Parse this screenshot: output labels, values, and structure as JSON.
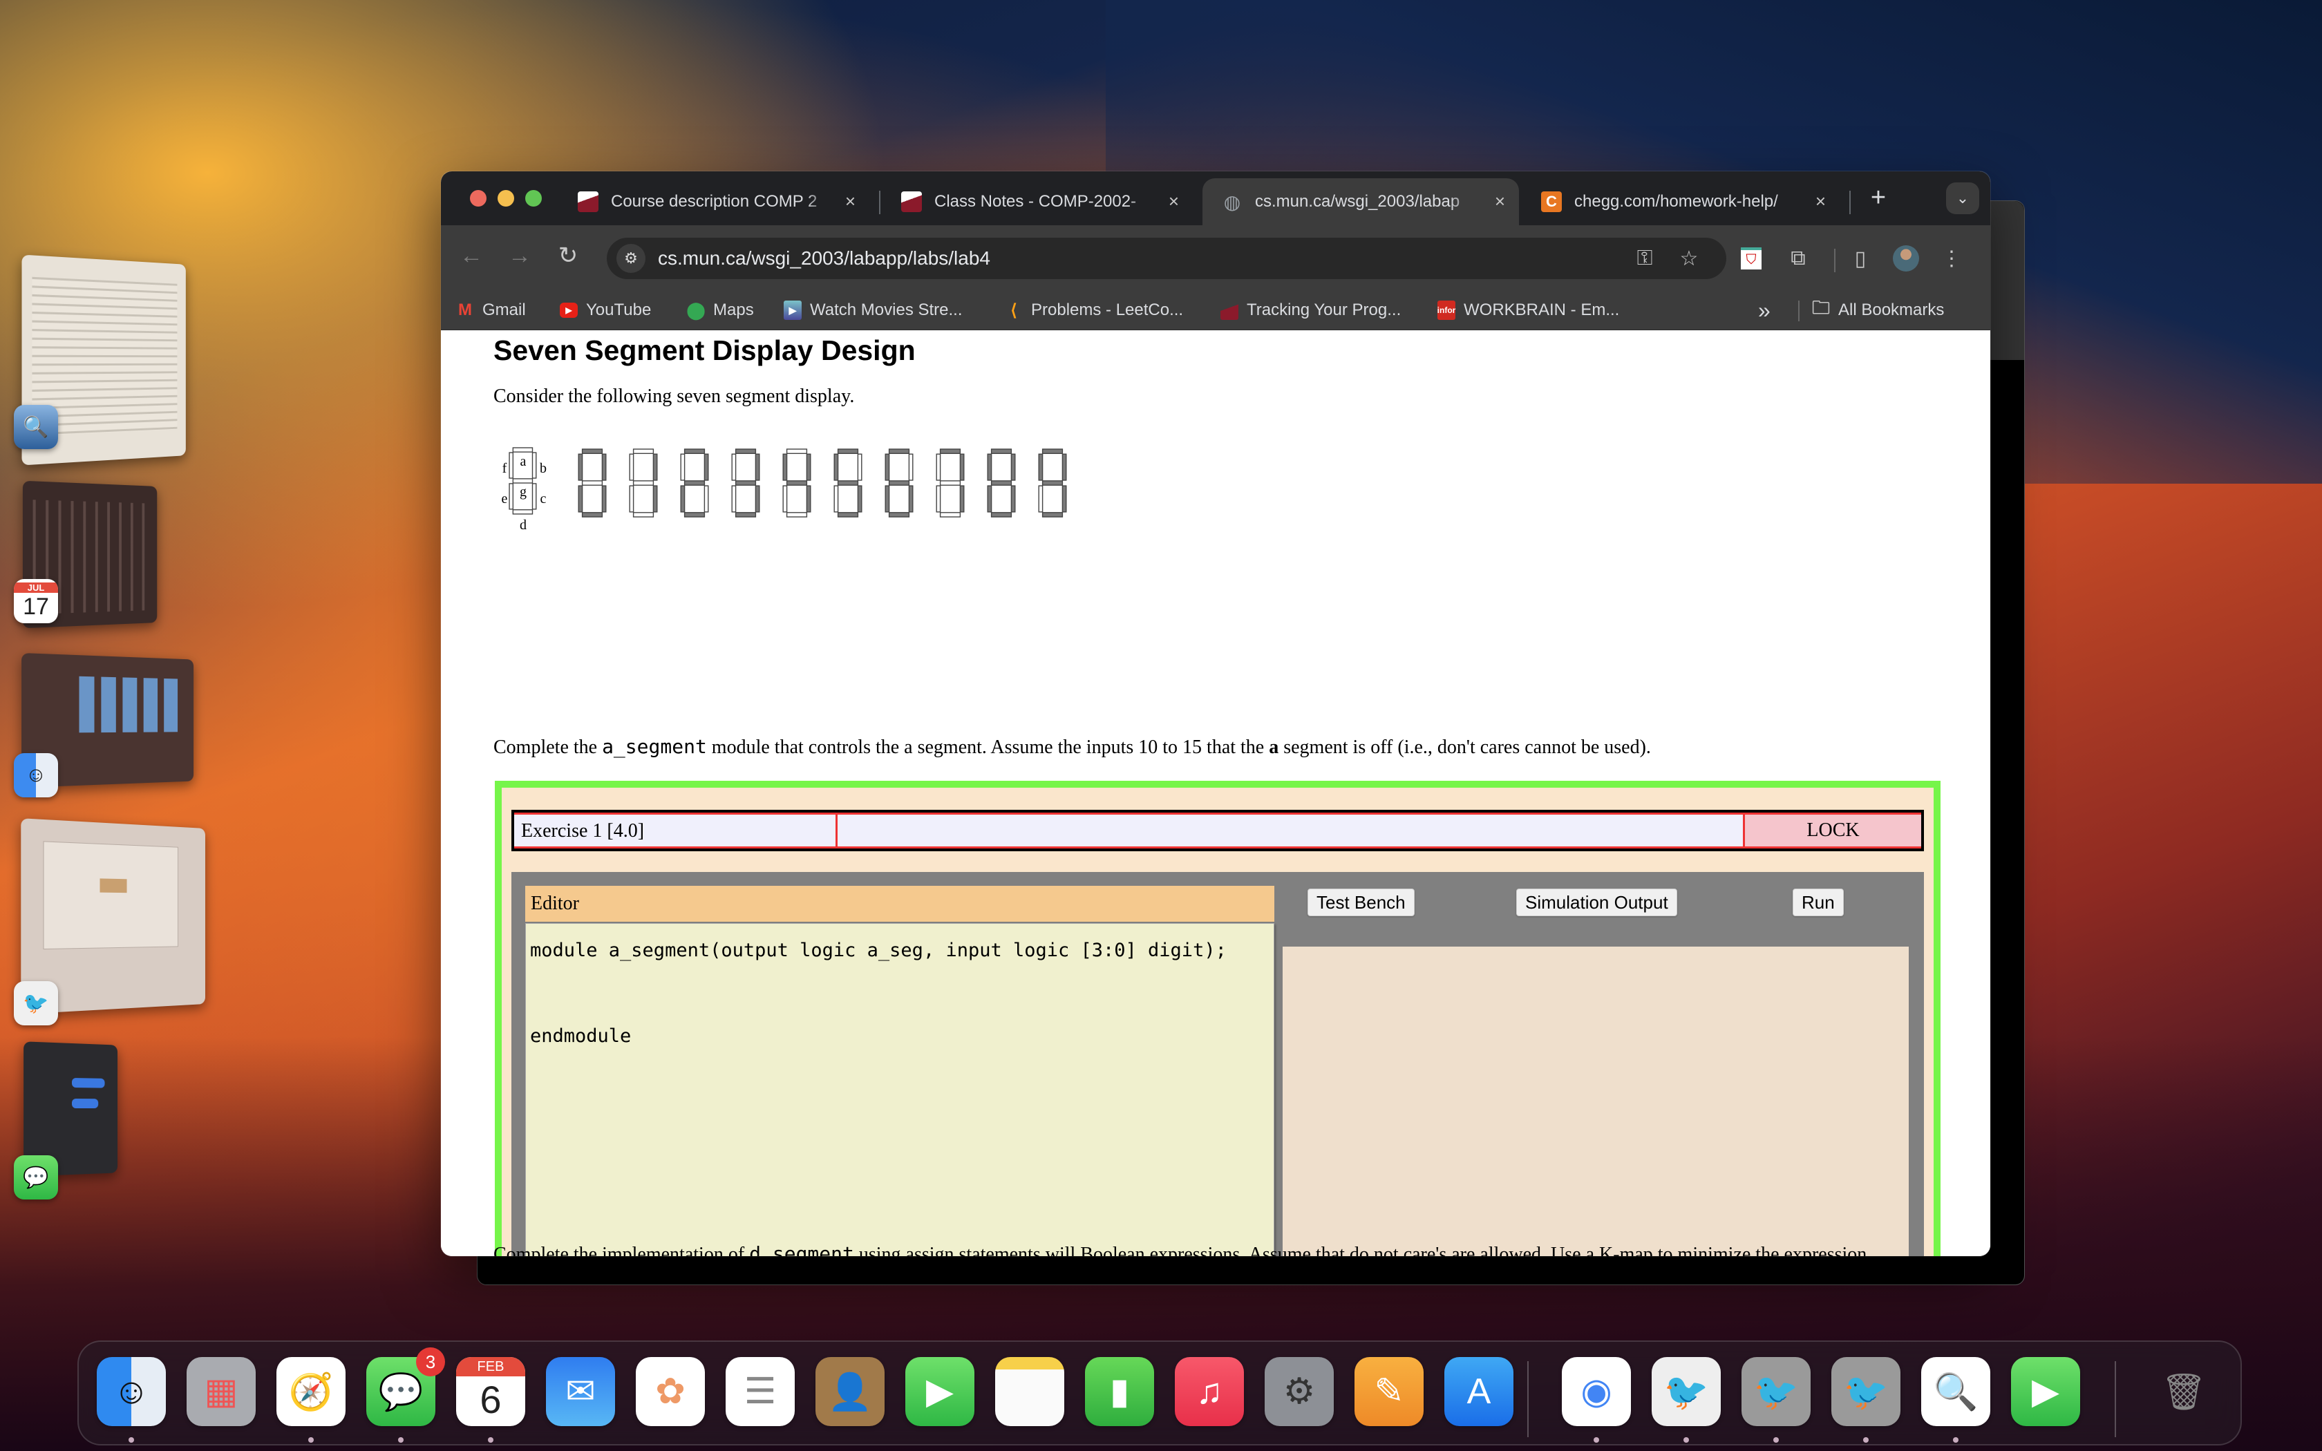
{
  "desktop": {
    "stage_manager": [
      {
        "name": "preview-window",
        "app": "Preview"
      },
      {
        "name": "calendar-window",
        "app": "Calendar",
        "app_badge_month": "JUL",
        "app_badge_day": "17"
      },
      {
        "name": "finder-window",
        "app": "Finder"
      },
      {
        "name": "bluej-window",
        "app": "BlueJ"
      },
      {
        "name": "messages-window",
        "app": "Messages"
      }
    ]
  },
  "browser": {
    "tabs": [
      {
        "title": "Course description COMP 2",
        "favicon": "memorial-university-icon",
        "active": false
      },
      {
        "title": "Class Notes - COMP-2002-",
        "favicon": "memorial-university-icon",
        "active": false
      },
      {
        "title": "cs.mun.ca/wsgi_2003/labap",
        "favicon": "globe-icon",
        "active": true
      },
      {
        "title": "chegg.com/homework-help/",
        "favicon": "chegg-icon",
        "active": false
      }
    ],
    "new_tab_label": "+",
    "url": "cs.mun.ca/wsgi_2003/labapp/labs/lab4",
    "bookmarks": [
      {
        "label": "Gmail",
        "icon": "gmail-icon"
      },
      {
        "label": "YouTube",
        "icon": "youtube-icon"
      },
      {
        "label": "Maps",
        "icon": "maps-icon"
      },
      {
        "label": "Watch Movies Stre...",
        "icon": "play-icon"
      },
      {
        "label": "Problems - LeetCo...",
        "icon": "leetcode-icon"
      },
      {
        "label": "Tracking Your Prog...",
        "icon": "memorial-university-icon"
      },
      {
        "label": "WORKBRAIN - Em...",
        "icon": "infor-icon",
        "icon_text": "infor"
      }
    ],
    "overflow_label": "»",
    "all_bookmarks_label": "All Bookmarks"
  },
  "page": {
    "title": "Seven Segment Display Design",
    "intro": "Consider the following seven segment display.",
    "segment_legend": {
      "a": "a",
      "b": "b",
      "c": "c",
      "d": "d",
      "e": "e",
      "f": "f",
      "g": "g"
    },
    "digits": [
      {
        "digit": 0,
        "on": [
          "a",
          "b",
          "c",
          "d",
          "e",
          "f"
        ]
      },
      {
        "digit": 1,
        "on": [
          "b",
          "c"
        ]
      },
      {
        "digit": 2,
        "on": [
          "a",
          "b",
          "d",
          "e",
          "g"
        ]
      },
      {
        "digit": 3,
        "on": [
          "a",
          "b",
          "c",
          "d",
          "g"
        ]
      },
      {
        "digit": 4,
        "on": [
          "b",
          "c",
          "f",
          "g"
        ]
      },
      {
        "digit": 5,
        "on": [
          "a",
          "c",
          "d",
          "f",
          "g"
        ]
      },
      {
        "digit": 6,
        "on": [
          "a",
          "c",
          "d",
          "e",
          "f",
          "g"
        ]
      },
      {
        "digit": 7,
        "on": [
          "a",
          "b",
          "c"
        ]
      },
      {
        "digit": 8,
        "on": [
          "a",
          "b",
          "c",
          "d",
          "e",
          "f",
          "g"
        ]
      },
      {
        "digit": 9,
        "on": [
          "a",
          "b",
          "c",
          "d",
          "f",
          "g"
        ]
      }
    ],
    "segment_on_color": "#7a7a7a",
    "task": {
      "prefix": "Complete the ",
      "code": "a_segment",
      "middle": " module that controls the a segment. Assume the inputs 10 to 15 that the ",
      "bold": "a",
      "suffix": " segment is off (i.e., don't cares cannot be used)."
    },
    "exercise": {
      "title": "Exercise 1 [4.0]",
      "status": "",
      "lock_label": "LOCK",
      "editor_label": "Editor",
      "code": "module a_segment(output logic a_seg, input logic [3:0] digit);\n\nendmodule",
      "buttons": {
        "test_bench": "Test Bench",
        "simulation_output": "Simulation Output",
        "run": "Run"
      },
      "output": ""
    },
    "next_task": {
      "prefix": "Complete the implementation of ",
      "code": "d_segment",
      "suffix": " using assign statements will Boolean expressions. Assume that do not care's are allowed. Use a K-map to minimize the expression."
    }
  },
  "dock": {
    "items": [
      {
        "name": "finder",
        "running": true
      },
      {
        "name": "launchpad",
        "running": false
      },
      {
        "name": "safari",
        "running": true
      },
      {
        "name": "messages",
        "running": true,
        "badge": "3"
      },
      {
        "name": "calendar",
        "running": true,
        "month": "FEB",
        "day": "6"
      },
      {
        "name": "mail",
        "running": false
      },
      {
        "name": "photos",
        "running": false
      },
      {
        "name": "reminders",
        "running": false
      },
      {
        "name": "contacts",
        "running": false
      },
      {
        "name": "facetime",
        "running": false
      },
      {
        "name": "notes",
        "running": false
      },
      {
        "name": "numbers",
        "running": false
      },
      {
        "name": "music",
        "running": false
      },
      {
        "name": "system-settings",
        "running": false
      },
      {
        "name": "pages",
        "running": false
      },
      {
        "name": "app-store",
        "running": false
      },
      {
        "name": "chrome",
        "running": true
      },
      {
        "name": "bluej",
        "running": true
      },
      {
        "name": "bluej-settings-1",
        "running": true
      },
      {
        "name": "bluej-settings-2",
        "running": true
      },
      {
        "name": "preview",
        "running": true
      },
      {
        "name": "facetime-iphone",
        "running": false
      },
      {
        "name": "trash",
        "running": false
      }
    ]
  }
}
